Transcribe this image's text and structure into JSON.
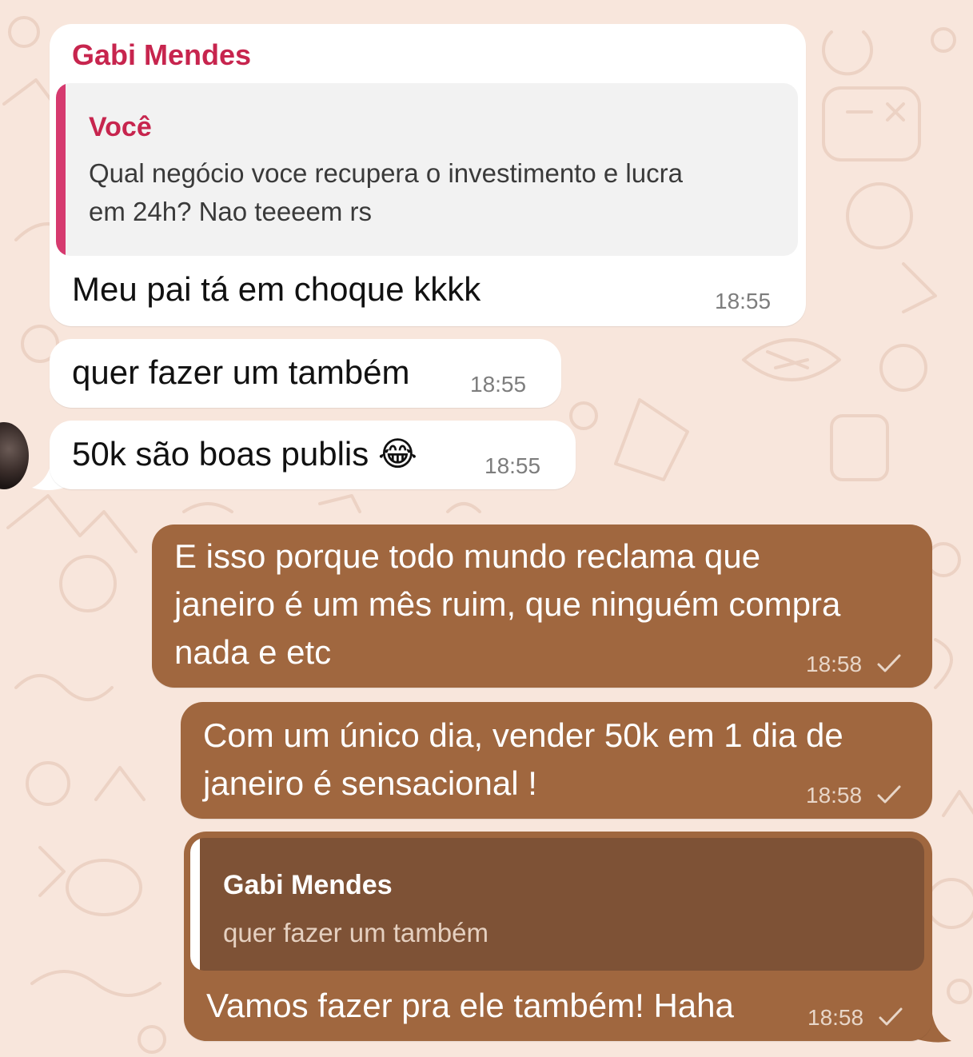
{
  "theme": {
    "background": "#f8e6dc",
    "incoming_bubble": "#ffffff",
    "outgoing_bubble": "#a0673f",
    "sender_name_color": "#c7254e",
    "quote_bar_incoming": "#d63a6f"
  },
  "messages": [
    {
      "direction": "incoming",
      "sender": "Gabi Mendes",
      "reply_to": {
        "author": "Você",
        "lines": [
          "Qual negócio voce recupera o investimento e lucra",
          "em 24h? Nao teeeem rs"
        ]
      },
      "text": "Meu pai tá em choque kkkk",
      "time": "18:55"
    },
    {
      "direction": "incoming",
      "text": "quer fazer um também",
      "time": "18:55"
    },
    {
      "direction": "incoming",
      "text": "50k são boas publis 😂",
      "time": "18:55",
      "avatar_icon": "contact-avatar"
    },
    {
      "direction": "outgoing",
      "lines": [
        "E isso porque todo mundo reclama que",
        "janeiro é um mês ruim, que ninguém compra",
        "nada e etc"
      ],
      "time": "18:58",
      "status_icon": "single-check-icon"
    },
    {
      "direction": "outgoing",
      "lines": [
        "Com um único dia, vender 50k em 1 dia de",
        "janeiro é sensacional !"
      ],
      "time": "18:58",
      "status_icon": "single-check-icon"
    },
    {
      "direction": "outgoing",
      "reply_to": {
        "author": "Gabi Mendes",
        "text": "quer fazer um também"
      },
      "text": "Vamos fazer pra ele também! Haha",
      "time": "18:58",
      "status_icon": "single-check-icon"
    }
  ]
}
